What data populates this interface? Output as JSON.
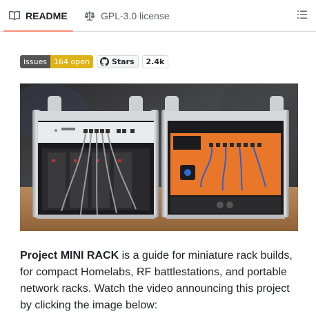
{
  "tabs": {
    "readme": "README",
    "license": "GPL-3.0 license"
  },
  "badges": {
    "issues_label": "issues",
    "issues_value": "164 open",
    "stars_label": "Stars",
    "stars_count": "2.4k"
  },
  "intro": {
    "bold": "Project MINI RACK",
    "text": " is a guide for miniature rack builds, for compact Homelabs, RF battlestations, and portable network racks. Watch the video announcing this project by clicking the image below:"
  },
  "icons": {
    "readme": "book-icon",
    "license": "law-scale-icon",
    "outline": "list-outline-icon",
    "stars": "github-mark-icon"
  },
  "colors": {
    "tab_underline": "#fd8c73",
    "badge_left": "#555555",
    "badge_right": "#dfb317",
    "text": "#1f2328",
    "muted": "#59636e"
  }
}
